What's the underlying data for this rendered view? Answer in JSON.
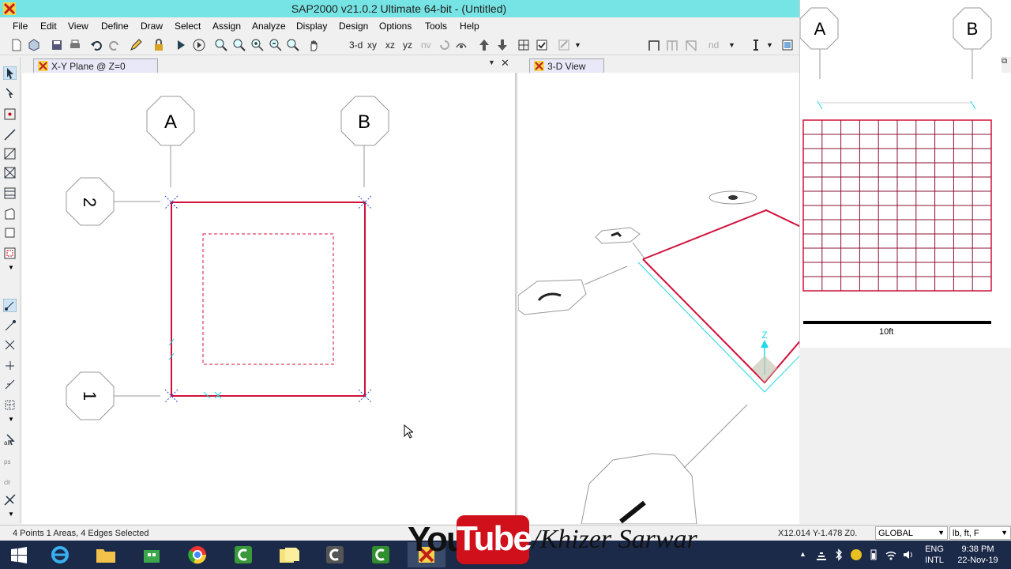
{
  "window": {
    "title": "SAP2000 v21.0.2 Ultimate 64-bit - (Untitled)"
  },
  "menu": {
    "items": [
      "File",
      "Edit",
      "View",
      "Define",
      "Draw",
      "Select",
      "Assign",
      "Analyze",
      "Display",
      "Design",
      "Options",
      "Tools",
      "Help"
    ]
  },
  "toolbar": {
    "view_3d": "3-d",
    "view_xy": "xy",
    "view_xz": "xz",
    "view_yz": "yz",
    "view_nv": "nv",
    "nd": "nd"
  },
  "left_tools": {
    "all_label": "all",
    "ps_label": "ps",
    "clr_label": "clr"
  },
  "pane_xy": {
    "tab_label": "X-Y Plane @ Z=0",
    "grid_labels": {
      "a": "A",
      "b": "B",
      "two": "2",
      "one": "1"
    }
  },
  "pane_3d": {
    "tab_label": "3-D View",
    "axis_label": "Z"
  },
  "thumbnail": {
    "grid_a": "A",
    "grid_b": "B",
    "scale_label": "10ft"
  },
  "status": {
    "selection": "4 Points  1 Areas, 4 Edges Selected",
    "coords": "X12.014  Y-1.478  Z0.",
    "coord_system": "GLOBAL",
    "units": "lb, ft, F"
  },
  "watermark": {
    "you": "You",
    "tube": "Tube",
    "channel": "/Khizer Sarwar"
  },
  "taskbar": {
    "lang_top": "ENG",
    "lang_bottom": "INTL",
    "time": "9:38 PM",
    "date": "22-Nov-19"
  },
  "colors": {
    "title_bar": "#76e4e4",
    "frame_red": "#d0103a",
    "cyan": "#20d8e8",
    "taskbar": "#1c2a4a"
  }
}
